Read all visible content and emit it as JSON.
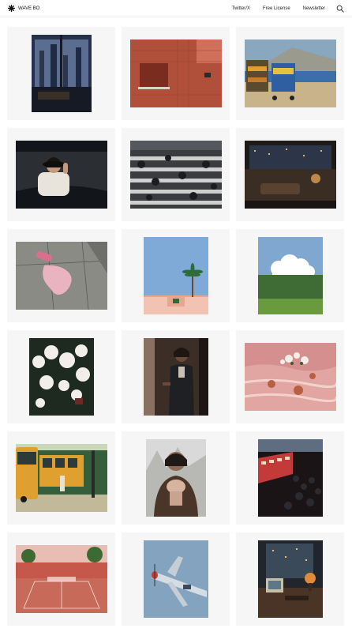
{
  "header": {
    "brand": "WAVE BO",
    "nav": [
      "Twitter/X",
      "Free License",
      "Newsletter"
    ]
  },
  "icons": {
    "logo": "asterisk-logo-icon",
    "search": "search-icon"
  },
  "gallery": [
    {
      "name": "photo-city-office-window",
      "colors": [
        "#26324a",
        "#5b6d90",
        "#151a24"
      ]
    },
    {
      "name": "photo-red-tile-bathroom",
      "colors": [
        "#b0503a",
        "#7a2d1e",
        "#d0705a"
      ]
    },
    {
      "name": "photo-fruit-stand-coast",
      "colors": [
        "#8aa7c0",
        "#c9b38a",
        "#3b6fa8"
      ]
    },
    {
      "name": "photo-woman-in-car",
      "colors": [
        "#2b2f33",
        "#e8e4dc",
        "#12161a"
      ]
    },
    {
      "name": "photo-crosswalk-crowd",
      "colors": [
        "#3a3c40",
        "#cfcfcf",
        "#1b1c1f"
      ]
    },
    {
      "name": "photo-luxury-night-apartment",
      "colors": [
        "#1e1a18",
        "#c08848",
        "#3a2e24"
      ]
    },
    {
      "name": "photo-pink-spill-sidewalk",
      "colors": [
        "#8b8b86",
        "#e9b4c0",
        "#5a5a57"
      ]
    },
    {
      "name": "photo-palm-basketball-court",
      "colors": [
        "#7fa9d6",
        "#f2c2b2",
        "#2e6b3a"
      ]
    },
    {
      "name": "photo-cloud-over-trees",
      "colors": [
        "#7fa7d0",
        "#ffffff",
        "#3f6b34"
      ]
    },
    {
      "name": "photo-white-flowers",
      "colors": [
        "#1e2a1f",
        "#f2eee8",
        "#6a2a28"
      ]
    },
    {
      "name": "photo-woman-in-doorway",
      "colors": [
        "#3a2e26",
        "#8a7060",
        "#1d1612"
      ]
    },
    {
      "name": "photo-pink-water-fruits",
      "colors": [
        "#d48f8e",
        "#f4d2cc",
        "#b86044"
      ]
    },
    {
      "name": "photo-yellow-bus-illustration",
      "colors": [
        "#355f3a",
        "#e0a030",
        "#c2b99a"
      ]
    },
    {
      "name": "photo-man-holding-child",
      "colors": [
        "#4a3628",
        "#d9d9d9",
        "#1f1a16"
      ]
    },
    {
      "name": "photo-subway-crowd",
      "colors": [
        "#1a1416",
        "#c23a3a",
        "#5e6e80"
      ]
    },
    {
      "name": "photo-red-tennis-court",
      "colors": [
        "#e8bdb3",
        "#c5584a",
        "#3d6a33"
      ]
    },
    {
      "name": "photo-vintage-airplane",
      "colors": [
        "#84a3bf",
        "#d5dde4",
        "#c24030"
      ]
    },
    {
      "name": "photo-retro-computer-desk",
      "colors": [
        "#20262c",
        "#e08a3a",
        "#5d7886"
      ]
    }
  ]
}
